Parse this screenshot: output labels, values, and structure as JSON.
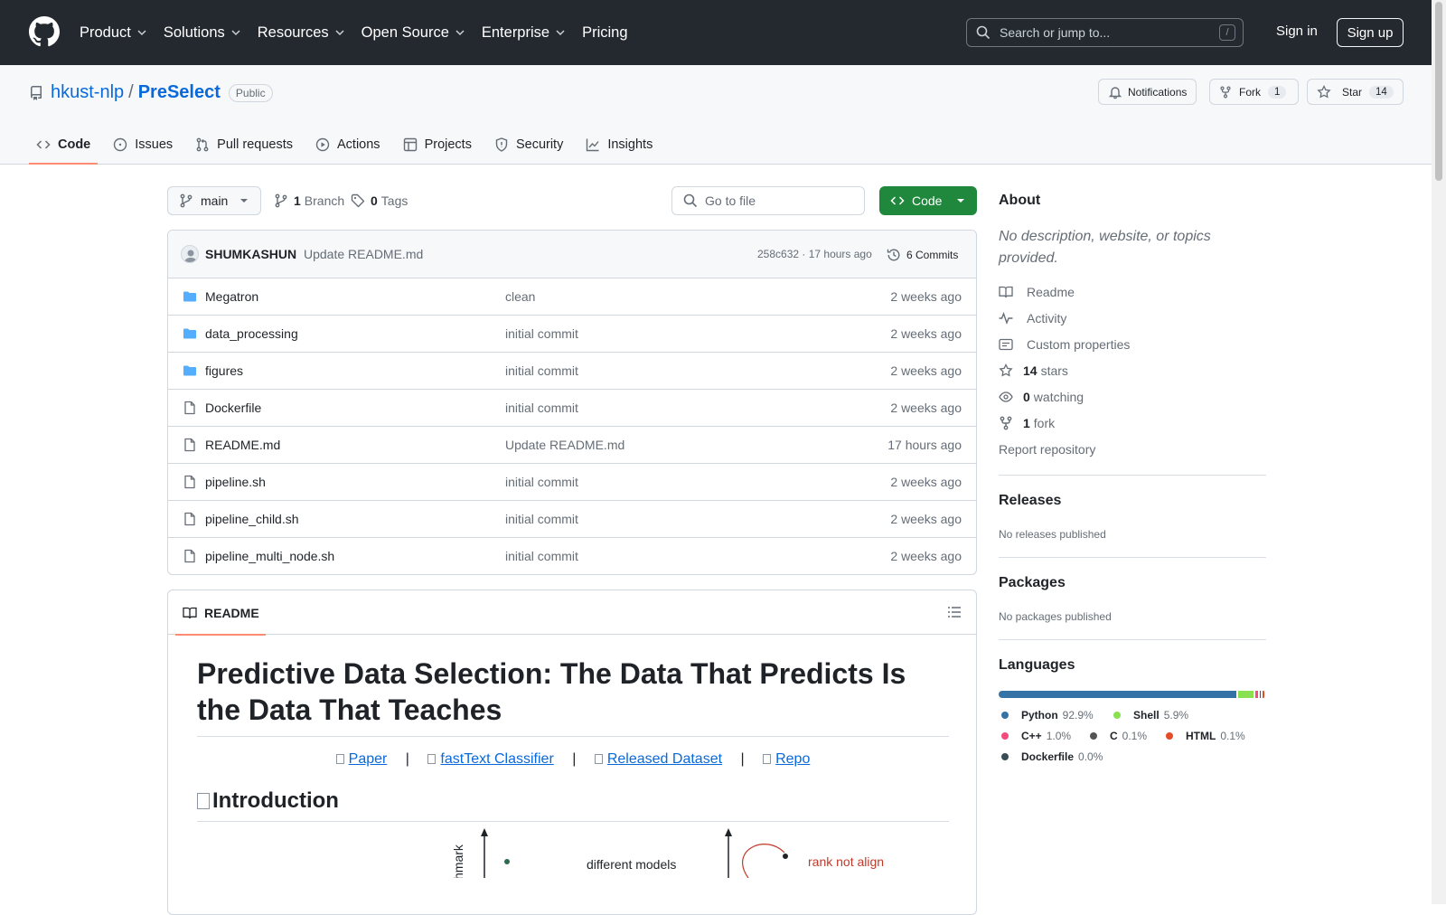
{
  "header": {
    "nav": [
      {
        "label": "Product",
        "chevron": true
      },
      {
        "label": "Solutions",
        "chevron": true
      },
      {
        "label": "Resources",
        "chevron": true
      },
      {
        "label": "Open Source",
        "chevron": true
      },
      {
        "label": "Enterprise",
        "chevron": true
      },
      {
        "label": "Pricing",
        "chevron": false
      }
    ],
    "search_placeholder": "Search or jump to...",
    "search_shortcut": "/",
    "sign_in": "Sign in",
    "sign_up": "Sign up"
  },
  "repo": {
    "owner": "hkust-nlp",
    "separator": "/",
    "name": "PreSelect",
    "visibility": "Public",
    "notifications_label": "Notifications",
    "fork_label": "Fork",
    "fork_count": "1",
    "star_label": "Star",
    "star_count": "14",
    "tabs": [
      {
        "label": "Code",
        "icon": "code-icon",
        "active": true
      },
      {
        "label": "Issues",
        "icon": "issue-icon",
        "active": false
      },
      {
        "label": "Pull requests",
        "icon": "pull-request-icon",
        "active": false
      },
      {
        "label": "Actions",
        "icon": "play-icon",
        "active": false
      },
      {
        "label": "Projects",
        "icon": "table-icon",
        "active": false
      },
      {
        "label": "Security",
        "icon": "shield-icon",
        "active": false
      },
      {
        "label": "Insights",
        "icon": "graph-icon",
        "active": false
      }
    ]
  },
  "toolbar": {
    "branch": "main",
    "branch_count": "1",
    "branch_label": "Branch",
    "tag_count": "0",
    "tag_label": "Tags",
    "goto_placeholder": "Go to file",
    "code_button": "Code"
  },
  "last_commit": {
    "author": "SHUMKASHUN",
    "message": "Update README.md",
    "hash_time": "258c632 · 17 hours ago",
    "commits_label": "6 Commits"
  },
  "files": [
    {
      "name": "Megatron",
      "type": "folder",
      "message": "clean",
      "date": "2 weeks ago"
    },
    {
      "name": "data_processing",
      "type": "folder",
      "message": "initial commit",
      "date": "2 weeks ago"
    },
    {
      "name": "figures",
      "type": "folder",
      "message": "initial commit",
      "date": "2 weeks ago"
    },
    {
      "name": "Dockerfile",
      "type": "file",
      "message": "initial commit",
      "date": "2 weeks ago"
    },
    {
      "name": "README.md",
      "type": "file",
      "message": "Update README.md",
      "date": "17 hours ago"
    },
    {
      "name": "pipeline.sh",
      "type": "file",
      "message": "initial commit",
      "date": "2 weeks ago"
    },
    {
      "name": "pipeline_child.sh",
      "type": "file",
      "message": "initial commit",
      "date": "2 weeks ago"
    },
    {
      "name": "pipeline_multi_node.sh",
      "type": "file",
      "message": "initial commit",
      "date": "2 weeks ago"
    }
  ],
  "readme": {
    "tab_label": "README",
    "title": "Predictive Data Selection: The Data That Predicts Is the Data That Teaches",
    "links": [
      "Paper",
      "fastText Classifier",
      "Released Dataset",
      "Repo"
    ],
    "link_separator": "|",
    "intro_heading": "Introduction",
    "figure_text_1": "hmark",
    "figure_text_2": "different models",
    "figure_text_3": "rank not align"
  },
  "sidebar": {
    "about_heading": "About",
    "description": "No description, website, or topics provided.",
    "links": [
      {
        "icon": "book-icon",
        "bold": "",
        "label": "Readme"
      },
      {
        "icon": "pulse-icon",
        "bold": "",
        "label": "Activity"
      },
      {
        "icon": "note-icon",
        "bold": "",
        "label": "Custom properties"
      },
      {
        "icon": "star-icon",
        "bold": "14",
        "label": "stars"
      },
      {
        "icon": "eye-icon",
        "bold": "0",
        "label": "watching"
      },
      {
        "icon": "fork-icon",
        "bold": "1",
        "label": "fork"
      }
    ],
    "report": "Report repository",
    "releases_heading": "Releases",
    "releases_text": "No releases published",
    "packages_heading": "Packages",
    "packages_text": "No packages published",
    "languages_heading": "Languages",
    "languages": [
      {
        "name": "Python",
        "pct": "92.9%",
        "value": 92.9,
        "color": "#3572A5"
      },
      {
        "name": "Shell",
        "pct": "5.9%",
        "value": 5.9,
        "color": "#89e051"
      },
      {
        "name": "C++",
        "pct": "1.0%",
        "value": 1.0,
        "color": "#f34b7d"
      },
      {
        "name": "C",
        "pct": "0.1%",
        "value": 0.1,
        "color": "#555555"
      },
      {
        "name": "HTML",
        "pct": "0.1%",
        "value": 0.1,
        "color": "#e34c26"
      },
      {
        "name": "Dockerfile",
        "pct": "0.0%",
        "value": 0.0,
        "color": "#384d54"
      }
    ]
  }
}
